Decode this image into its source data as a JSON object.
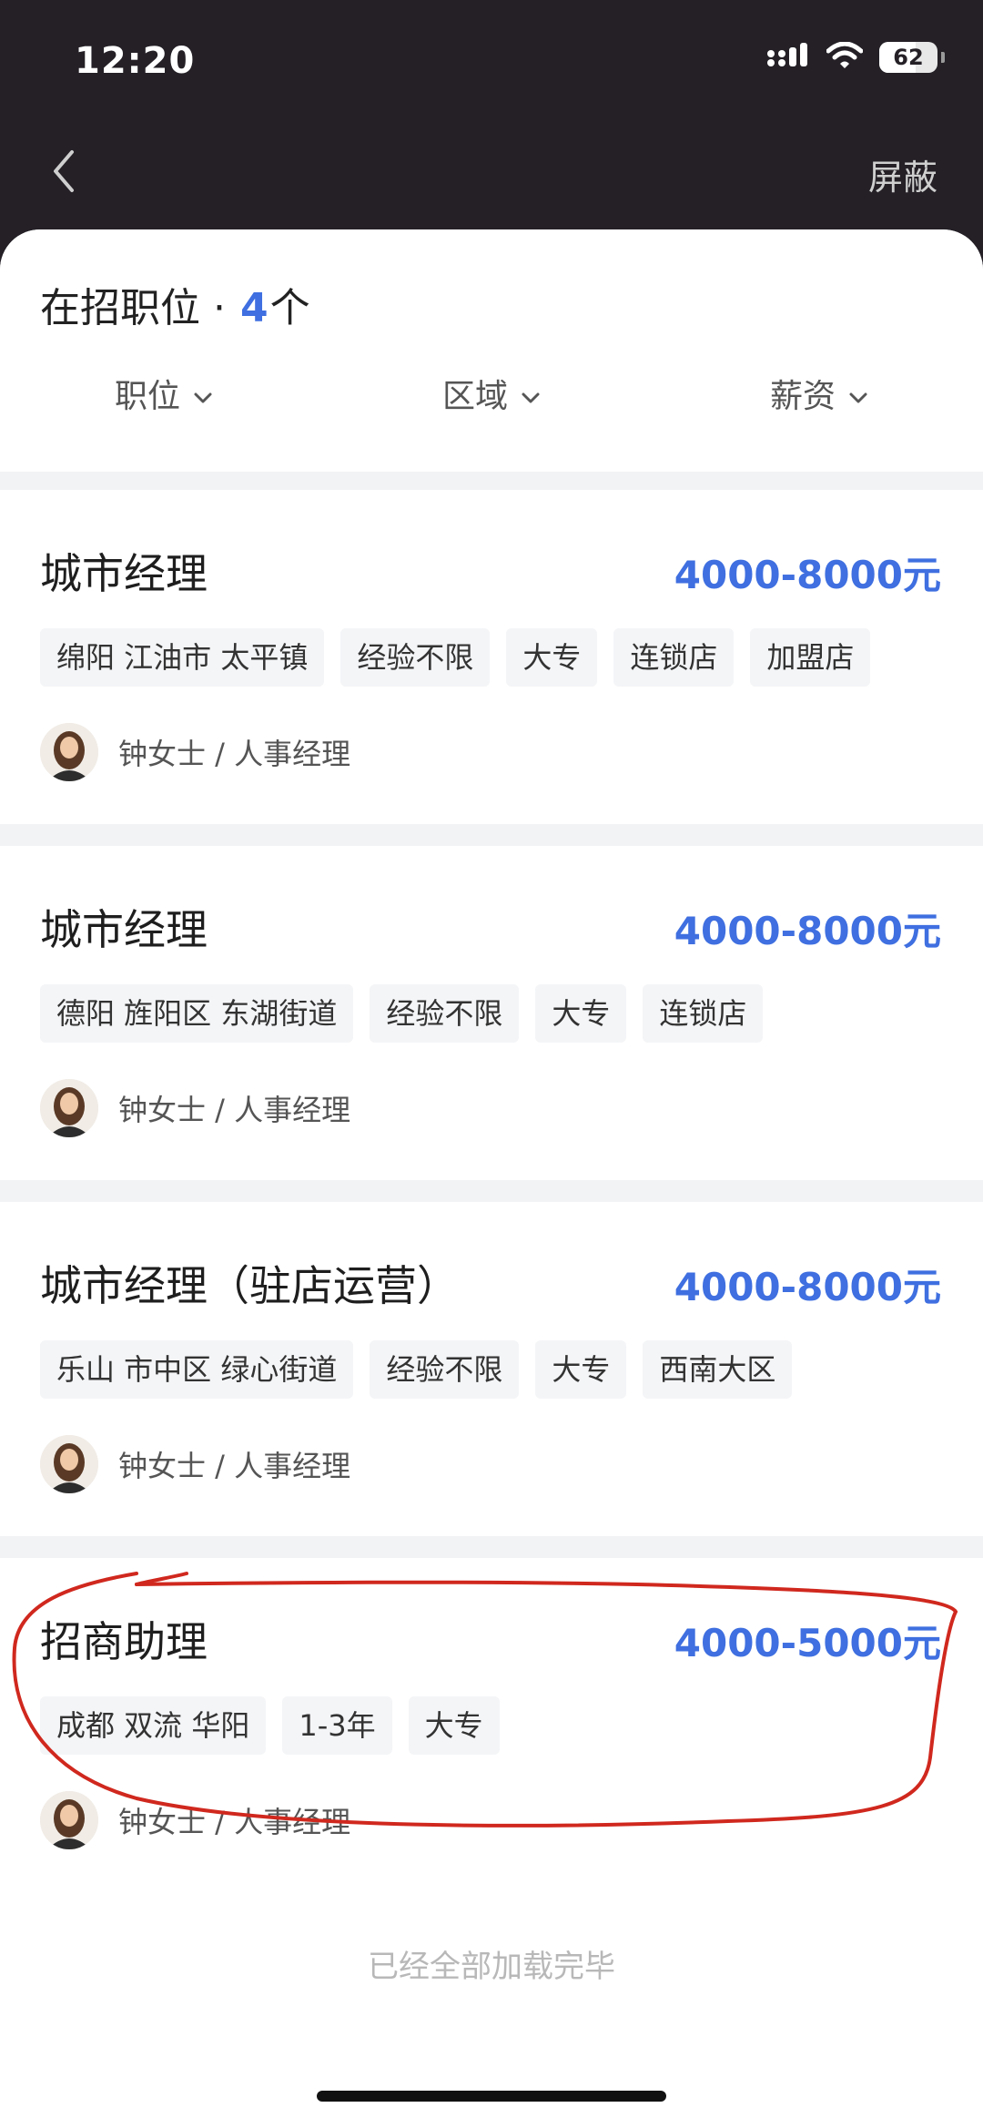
{
  "status_bar": {
    "time": "12:20",
    "battery_level": "62",
    "battery_fraction": 0.62
  },
  "nav": {
    "back_icon": "chevron-left-icon",
    "block_label": "屏蔽"
  },
  "header": {
    "title": "在招职位 · ",
    "count": "4",
    "count_suffix": "个"
  },
  "filters": [
    {
      "label": "职位",
      "icon": "chevron-down-icon"
    },
    {
      "label": "区域",
      "icon": "chevron-down-icon"
    },
    {
      "label": "薪资",
      "icon": "chevron-down-icon"
    }
  ],
  "jobs": [
    {
      "title": "城市经理",
      "salary": "4000-8000元",
      "tags": [
        "绵阳 江油市 太平镇",
        "经验不限",
        "大专",
        "连锁店",
        "加盟店"
      ],
      "recruiter": "钟女士 / 人事经理"
    },
    {
      "title": "城市经理",
      "salary": "4000-8000元",
      "tags": [
        "德阳 旌阳区 东湖街道",
        "经验不限",
        "大专",
        "连锁店"
      ],
      "recruiter": "钟女士 / 人事经理"
    },
    {
      "title": "城市经理（驻店运营）",
      "salary": "4000-8000元",
      "tags": [
        "乐山 市中区 绿心街道",
        "经验不限",
        "大专",
        "西南大区"
      ],
      "recruiter": "钟女士 / 人事经理"
    },
    {
      "title": "招商助理",
      "salary": "4000-5000元",
      "tags": [
        "成都 双流 华阳",
        "1-3年",
        "大专"
      ],
      "recruiter": "钟女士 / 人事经理"
    }
  ],
  "footer": {
    "load_complete": "已经全部加载完毕"
  },
  "colors": {
    "accent": "#3f6fe0",
    "header_bg": "#242026",
    "annotation": "#d0281e"
  }
}
